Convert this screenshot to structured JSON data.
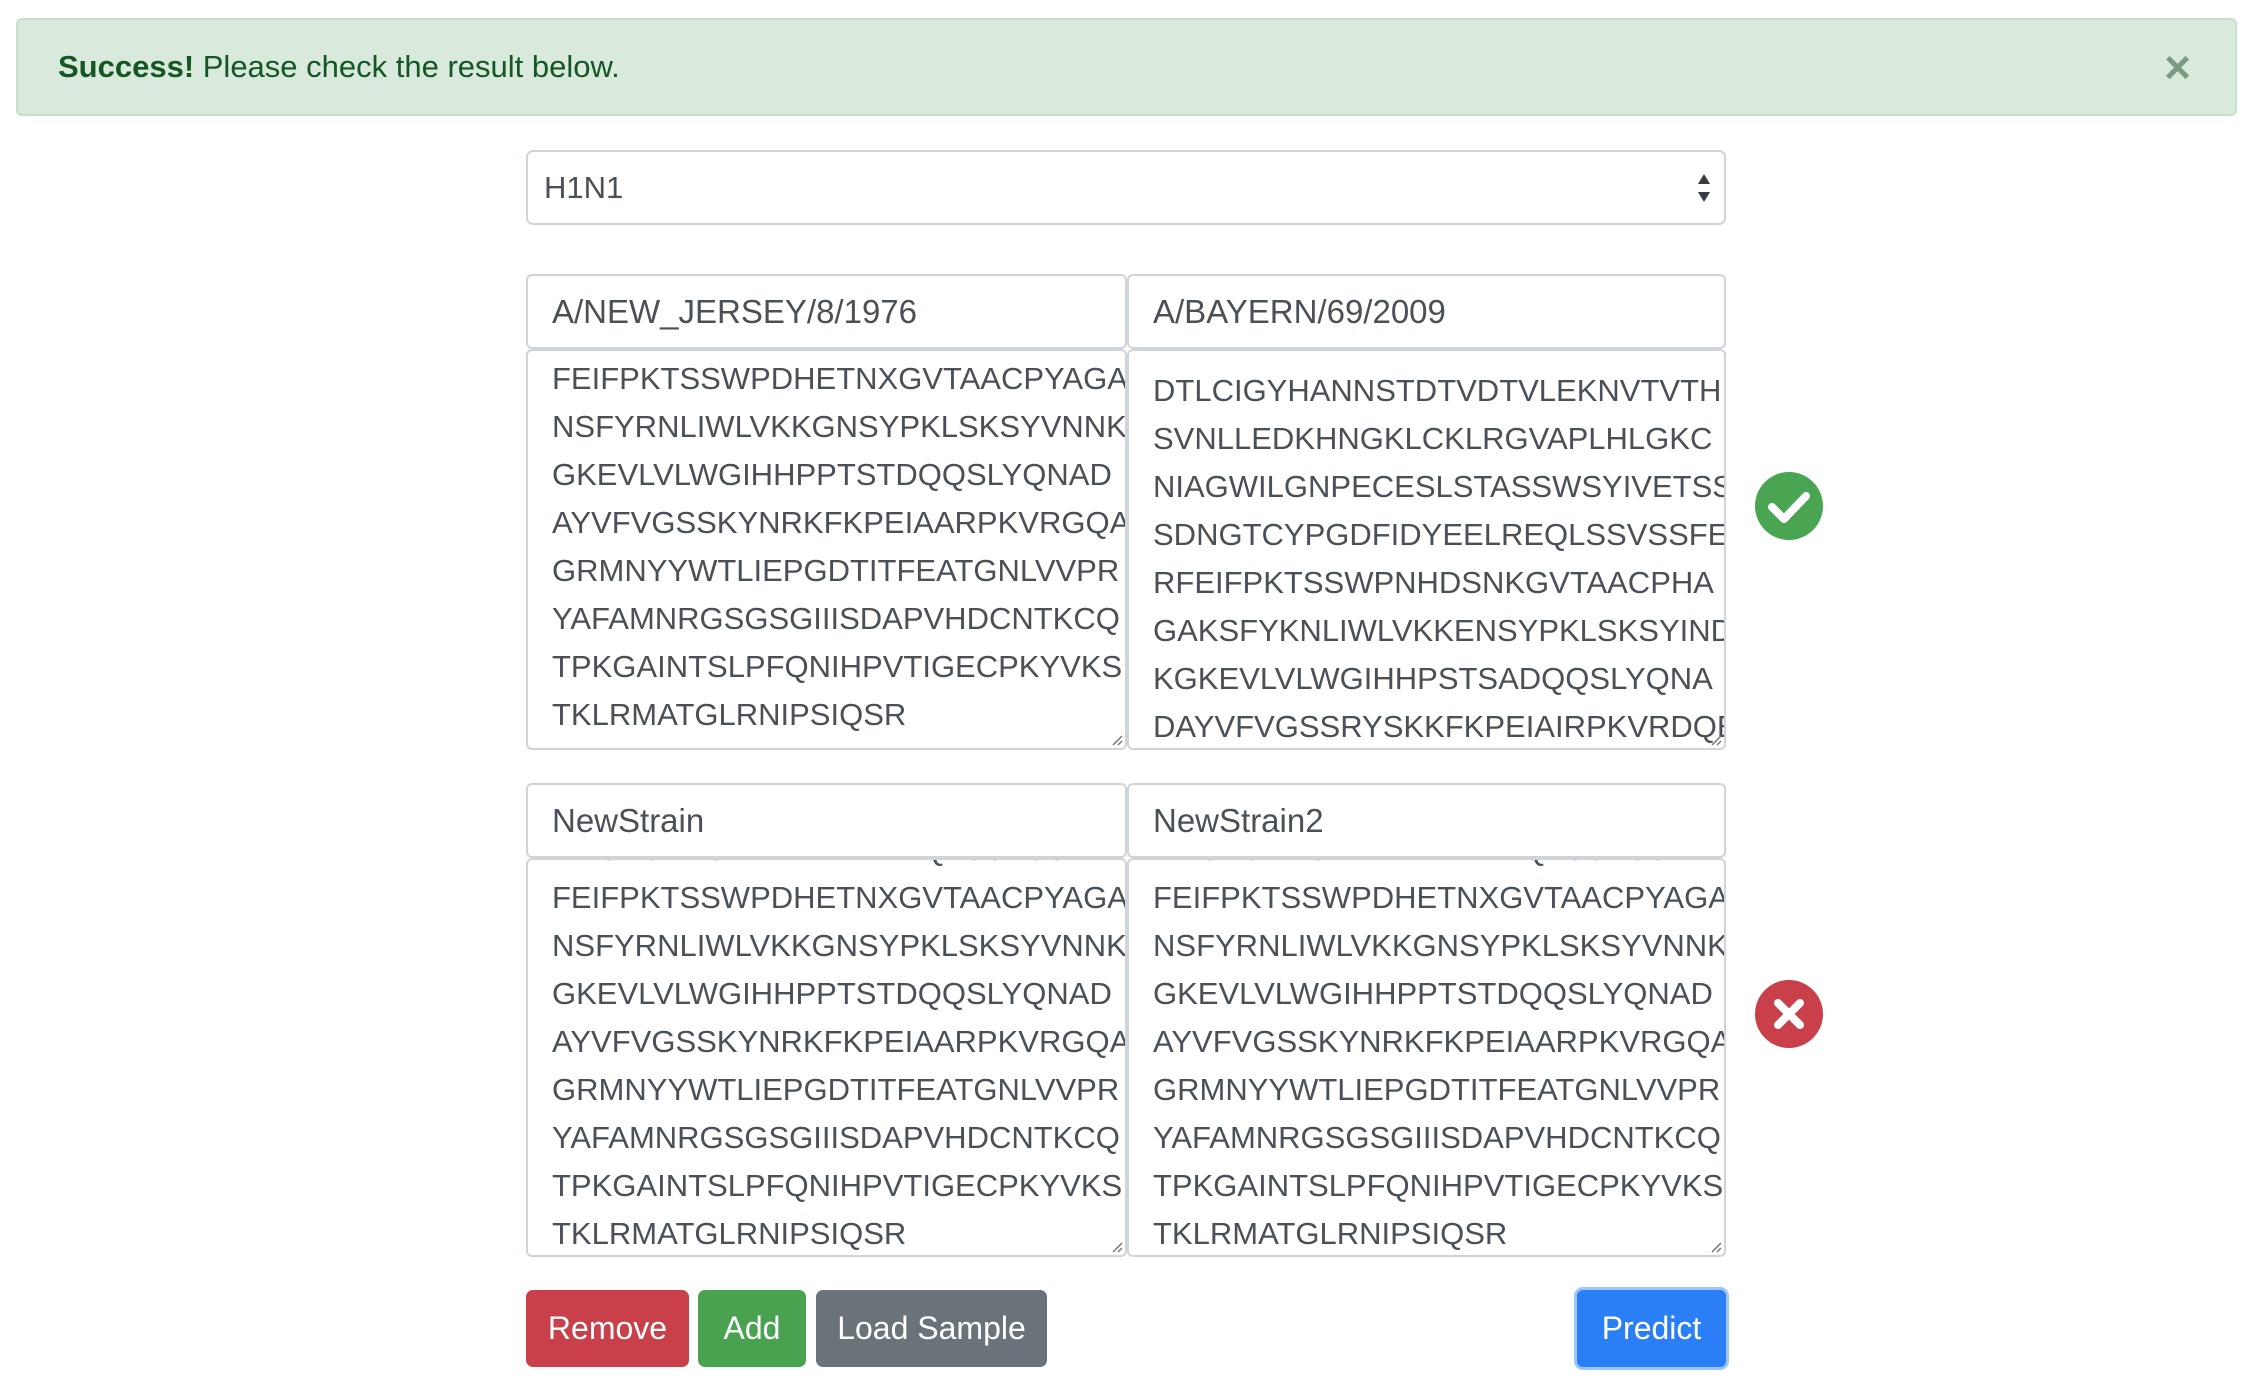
{
  "alert": {
    "strong": "Success!",
    "message": " Please check the result below.",
    "close": "×"
  },
  "subtype_select": {
    "value": "H1N1"
  },
  "pairs": [
    {
      "left_name": "A/NEW_JERSEY/8/1976",
      "right_name": "A/BAYERN/69/2009",
      "left_partial_top": "",
      "left_lines": [
        "FEIFPKTSSWPDHETNXGVTAACPYAGA",
        "NSFYRNLIWLVKKGNSYPKLSKSYVNNK",
        "GKEVLVLWGIHHPPTSTDQQSLYQNAD",
        "AYVFVGSSKYNRKFKPEIAARPKVRGQA",
        "GRMNYYWTLIEPGDTITFEATGNLVVPR",
        "YAFAMNRGSGSGIIISDAPVHDCNTKCQ",
        "TPKGAINTSLPFQNIHPVTIGECPKYVKS",
        "TKLRMATGLRNIPSIQSR"
      ],
      "right_lines": [
        "DTLCIGYHANNSTDTVDTVLEKNVTVTH",
        "SVNLLEDKHNGKLCKLRGVAPLHLGKC",
        "NIAGWILGNPECESLSTASSWSYIVETSS",
        "SDNGTCYPGDFIDYEELREQLSSVSSFE",
        "RFEIFPKTSSWPNHDSNKGVTAACPHA",
        "GAKSFYKNLIWLVKKENSYPKLSKSYIND",
        "KGKEVLVLWGIHHPSTSADQQSLYQNA",
        "DAYVFVGSSRYSKKFKPEIAIRPKVRDQE"
      ],
      "result": "match",
      "result_icon": "check-circle-icon",
      "result_color": "#4aa552"
    },
    {
      "left_name": "NewStrain",
      "right_name": "NewStrain2",
      "left_partial_top": "DNGTCYPGDFINYEELREQLSSVSSFER",
      "right_partial_top": "DNGTCYPGDFINYEELREQLSSVSSFER",
      "left_lines": [
        "FEIFPKTSSWPDHETNXGVTAACPYAGA",
        "NSFYRNLIWLVKKGNSYPKLSKSYVNNK",
        "GKEVLVLWGIHHPPTSTDQQSLYQNAD",
        "AYVFVGSSKYNRKFKPEIAARPKVRGQA",
        "GRMNYYWTLIEPGDTITFEATGNLVVPR",
        "YAFAMNRGSGSGIIISDAPVHDCNTKCQ",
        "TPKGAINTSLPFQNIHPVTIGECPKYVKS",
        "TKLRMATGLRNIPSIQSR"
      ],
      "right_lines": [
        "FEIFPKTSSWPDHETNXGVTAACPYAGA",
        "NSFYRNLIWLVKKGNSYPKLSKSYVNNK",
        "GKEVLVLWGIHHPPTSTDQQSLYQNAD",
        "AYVFVGSSKYNRKFKPEIAARPKVRGQA",
        "GRMNYYWTLIEPGDTITFEATGNLVVPR",
        "YAFAMNRGSGSGIIISDAPVHDCNTKCQ",
        "TPKGAINTSLPFQNIHPVTIGECPKYVKS",
        "TKLRMATGLRNIPSIQSR"
      ],
      "result": "mismatch",
      "result_icon": "x-circle-icon",
      "result_color": "#c9404b"
    }
  ],
  "buttons": {
    "remove": "Remove",
    "add": "Add",
    "load_sample": "Load Sample",
    "predict": "Predict"
  }
}
